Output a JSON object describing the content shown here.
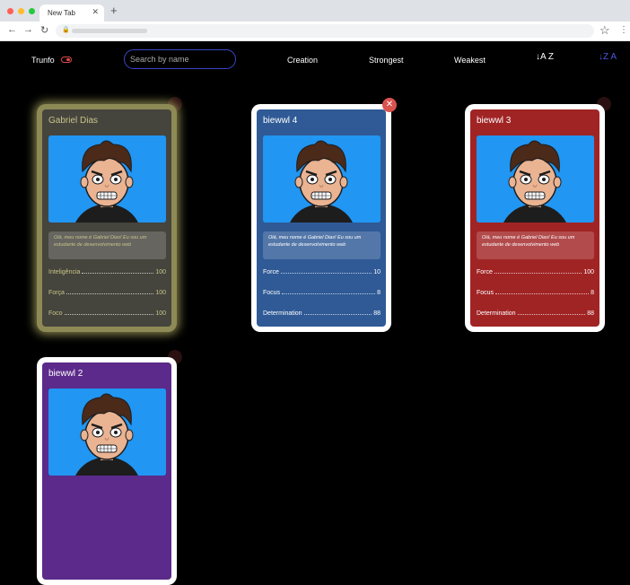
{
  "browser": {
    "tab_title": "New Tab",
    "tab_close": "✕",
    "new_tab": "+",
    "back": "←",
    "forward": "→",
    "reload": "↻",
    "lock": "🔒",
    "star": "☆",
    "menu": "⋮"
  },
  "nav": {
    "trunfo_label": "Trunfo",
    "search_placeholder": "Search by name",
    "creation": "Creation",
    "strongest": "Strongest",
    "weakest": "Weakest",
    "sort_asc_icon": "↓A Z",
    "sort_desc_icon": "↓Z A"
  },
  "colors": {
    "gold_card": "#45443d",
    "blue_card": "#2f5a96",
    "red_card": "#a12425",
    "purple_card": "#5b2a8a",
    "image_bg": "#2196f3",
    "delete_badge": "#d9534f"
  },
  "cards": [
    {
      "name": "Gabriel Dias",
      "description": "Olá, meu nome é Gabriel Dias! Eu sou um estudante de desenvolvimento web",
      "attrs": [
        {
          "label": "Inteligência",
          "value": "100"
        },
        {
          "label": "Força",
          "value": "100"
        },
        {
          "label": "Foco",
          "value": "100"
        }
      ],
      "trunfo": true
    },
    {
      "name": "biewwl 4",
      "description": "Olá, meu nome é Gabriel Dias! Eu sou um estudante de desenvolvimento web",
      "attrs": [
        {
          "label": "Force",
          "value": "10"
        },
        {
          "label": "Focus",
          "value": "8"
        },
        {
          "label": "Determination",
          "value": "88"
        }
      ],
      "delete": "✕"
    },
    {
      "name": "biewwl 3",
      "description": "Olá, meu nome é Gabriel Dias! Eu sou um estudante de desenvolvimento web",
      "attrs": [
        {
          "label": "Force",
          "value": "100"
        },
        {
          "label": "Focus",
          "value": "8"
        },
        {
          "label": "Determination",
          "value": "88"
        }
      ]
    },
    {
      "name": "biewwl 2"
    }
  ]
}
